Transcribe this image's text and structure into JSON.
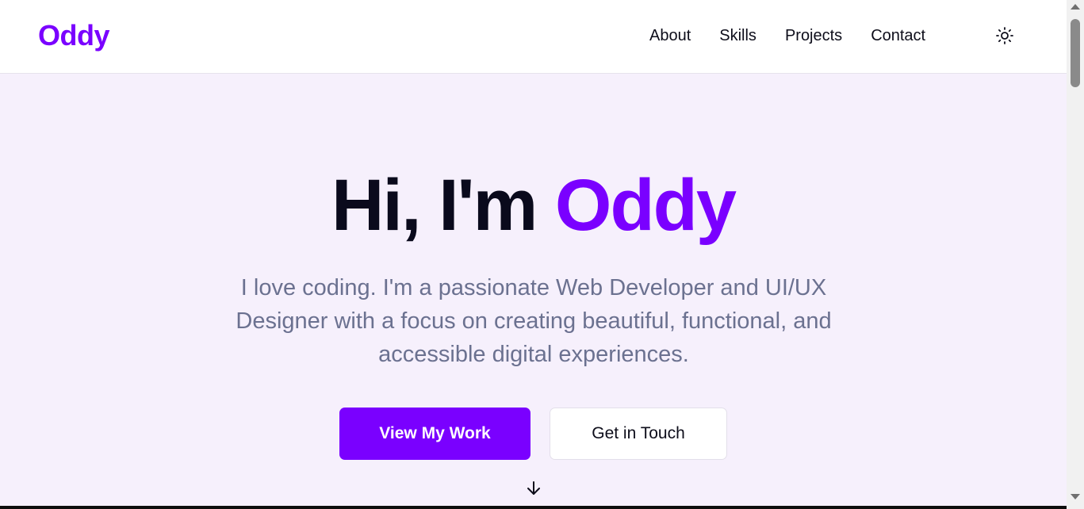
{
  "brand": {
    "logo": "Oddy",
    "accent_color": "#7a00ff"
  },
  "nav": {
    "links": [
      {
        "label": "About"
      },
      {
        "label": "Skills"
      },
      {
        "label": "Projects"
      },
      {
        "label": "Contact"
      }
    ],
    "theme_toggle_icon": "sun-icon"
  },
  "hero": {
    "greeting": "Hi, I'm",
    "name": "Oddy",
    "description": "I love coding. I'm a passionate Web Developer and UI/UX Designer with a focus on creating beautiful, functional, and accessible digital experiences.",
    "primary_button": "View My Work",
    "secondary_button": "Get in Touch",
    "scroll_icon": "arrow-down-icon",
    "background_color": "#f6f0fc"
  }
}
